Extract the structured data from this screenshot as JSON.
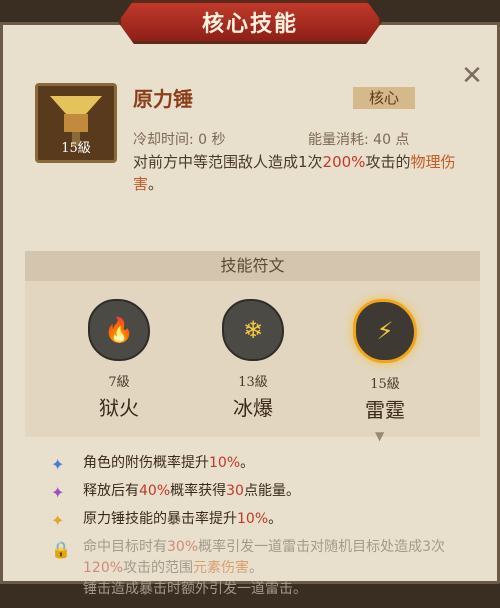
{
  "title": "核心技能",
  "close_label": "✕",
  "skill": {
    "name": "原力锤",
    "tag": "核心",
    "level": "15級",
    "cooldown": "冷却时间: 0 秒",
    "energy": "能量消耗: 40 点",
    "desc_a": "对前方中等范围敌人造成1次",
    "desc_b": "200%",
    "desc_c": "攻击的",
    "desc_d": "物理伤害",
    "desc_e": "。"
  },
  "runes": {
    "header": "技能符文",
    "items": [
      {
        "level": "7級",
        "name": "狱火",
        "glyph": "🔥"
      },
      {
        "level": "13級",
        "name": "冰爆",
        "glyph": "❄"
      },
      {
        "level": "15級",
        "name": "雷霆",
        "glyph": "⚡"
      }
    ]
  },
  "effects": [
    {
      "a": "角色的附伤概率提升",
      "b": "10%",
      "c": "。"
    },
    {
      "a": "释放后有",
      "b": "40%",
      "c": "概率获得",
      "d": "30",
      "e": "点能量。"
    },
    {
      "a": "原力锤技能的暴击率提升",
      "b": "10%",
      "c": "。"
    }
  ],
  "locked_effect": {
    "a": "命中目标时有",
    "b": "30%",
    "c": "概率引发一道雷击对随机目标处造成3次",
    "d": "120%",
    "e": "攻击的范围",
    "f": "元素伤害",
    "g": "。",
    "h": "锤击造成暴击时额外引发一道雷击。"
  },
  "colors": {
    "accent_red": "#c0392b",
    "rune_active": "#f0a51c",
    "banner": "#a83224"
  }
}
